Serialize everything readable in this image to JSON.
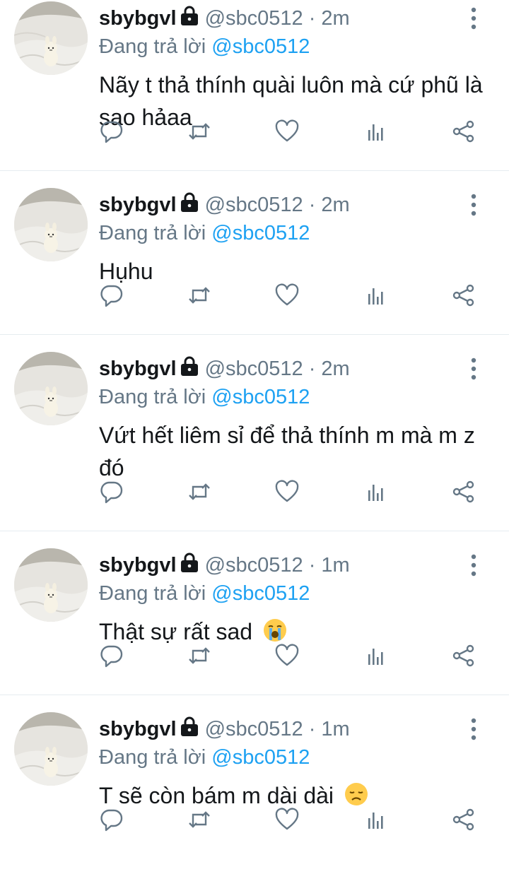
{
  "colors": {
    "text": "#14171a",
    "secondary": "#657786",
    "link": "#1da1f2",
    "icon": "#657786",
    "divider": "#e6ecf0"
  },
  "tweets": [
    {
      "display_name": "sbybgvl",
      "handle": "@sbc0512",
      "dot": "·",
      "time": "2m",
      "reply_prefix": "Đang trả lời",
      "reply_to": "@sbc0512",
      "text": "Nãy t thả thính quài luôn mà cứ phũ là sao hảaa",
      "emoji": "",
      "icons": [
        "lock-icon",
        "more-icon",
        "reply-icon",
        "retweet-icon",
        "like-icon",
        "stats-icon",
        "share-icon"
      ]
    },
    {
      "display_name": "sbybgvl",
      "handle": "@sbc0512",
      "dot": "·",
      "time": "2m",
      "reply_prefix": "Đang trả lời",
      "reply_to": "@sbc0512",
      "text": "Hụhu",
      "emoji": ""
    },
    {
      "display_name": "sbybgvl",
      "handle": "@sbc0512",
      "dot": "·",
      "time": "2m",
      "reply_prefix": "Đang trả lời",
      "reply_to": "@sbc0512",
      "text": "Vứt hết liêm sỉ để thả thính m mà m z đó",
      "emoji": ""
    },
    {
      "display_name": "sbybgvl",
      "handle": "@sbc0512",
      "dot": "·",
      "time": "1m",
      "reply_prefix": "Đang trả lời",
      "reply_to": "@sbc0512",
      "text": "Thật sự rất sad",
      "emoji": "loudly-crying-face"
    },
    {
      "display_name": "sbybgvl",
      "handle": "@sbc0512",
      "dot": "·",
      "time": "1m",
      "reply_prefix": "Đang trả lời",
      "reply_to": "@sbc0512",
      "text": "T sẽ còn bám m dài dài",
      "emoji": "disappointed-face"
    }
  ]
}
